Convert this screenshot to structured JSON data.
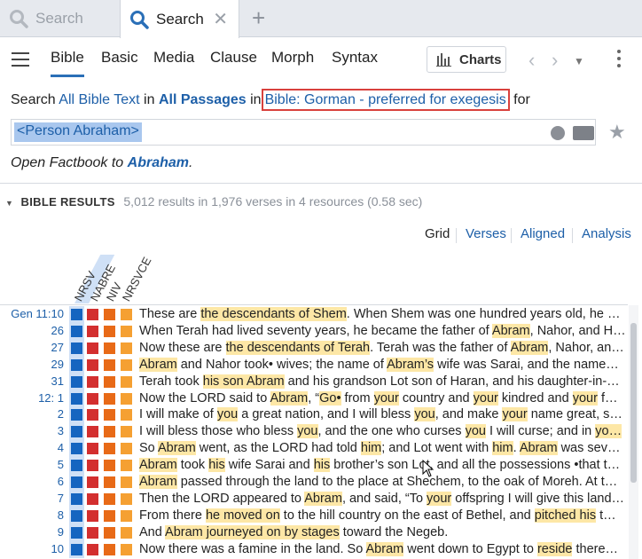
{
  "tabs": {
    "inactive_label": "Search",
    "active_label": "Search",
    "close_glyph": "✕",
    "new_glyph": "+"
  },
  "toolbar": {
    "tabs": [
      "Bible",
      "Basic",
      "Media",
      "Clause",
      "Morph",
      "Syntax"
    ],
    "selected": "Bible",
    "charts_label": "Charts"
  },
  "search": {
    "prefix": "Search",
    "scope": "All Bible Text",
    "in1": "in",
    "passages": "All Passages",
    "in2": "in",
    "resource": "Bible: Gorman - preferred for exegesis",
    "for": "for",
    "query": "<Person Abraham>"
  },
  "factbook": {
    "prefix": "Open Factbook to",
    "target": "Abraham",
    "suffix": "."
  },
  "results": {
    "title": "BIBLE RESULTS",
    "stats": "5,012 results in 1,976 verses in 4 resources (0.58 sec)"
  },
  "views": [
    "Grid",
    "Verses",
    "Aligned",
    "Analysis"
  ],
  "resources": [
    "NRSV",
    "NABRE",
    "NIV",
    "NRSVCE"
  ],
  "colors": {
    "nrsv": "#1565c0",
    "nabre": "#d32f2f",
    "niv": "#e86a17",
    "nrsvce": "#f5a032",
    "highlight": "#fde7a6",
    "link": "#1d5fa8"
  },
  "rows": [
    {
      "ref": "Gen 11:10",
      "segs": [
        [
          "These are ",
          0
        ],
        [
          "the descendants of Shem",
          1
        ],
        [
          ". When Shem was one hundred years old, he b…",
          0
        ]
      ]
    },
    {
      "ref": "26",
      "segs": [
        [
          "When Terah had lived seventy years, he became the father of ",
          0
        ],
        [
          "Abram",
          1
        ],
        [
          ", Nahor, and H…",
          0
        ]
      ]
    },
    {
      "ref": "27",
      "segs": [
        [
          "Now these are ",
          0
        ],
        [
          "the descendants of Terah",
          1
        ],
        [
          ". Terah was the father of ",
          0
        ],
        [
          "Abram",
          1
        ],
        [
          ", Nahor, an…",
          0
        ]
      ]
    },
    {
      "ref": "29",
      "segs": [
        [
          "Abram",
          1
        ],
        [
          " and Nahor took• wives; the name of ",
          0
        ],
        [
          "Abram’s",
          1
        ],
        [
          " wife was Sarai, and the name…",
          0
        ]
      ]
    },
    {
      "ref": "31",
      "segs": [
        [
          "Terah took ",
          0
        ],
        [
          "his son Abram",
          1
        ],
        [
          " and his grandson Lot son of Haran, and his daughter-in-…",
          0
        ]
      ]
    },
    {
      "ref": "12: 1",
      "segs": [
        [
          "Now the LORD said to ",
          0
        ],
        [
          "Abram",
          1
        ],
        [
          ", “",
          0
        ],
        [
          "Go•",
          1
        ],
        [
          " from ",
          0
        ],
        [
          "your",
          1
        ],
        [
          " country and ",
          0
        ],
        [
          "your",
          1
        ],
        [
          " kindred and ",
          0
        ],
        [
          "your",
          1
        ],
        [
          " f…",
          0
        ]
      ]
    },
    {
      "ref": "2",
      "segs": [
        [
          "I will make of ",
          0
        ],
        [
          "you",
          1
        ],
        [
          " a great nation, and I will bless ",
          0
        ],
        [
          "you",
          1
        ],
        [
          ", and make ",
          0
        ],
        [
          "your",
          1
        ],
        [
          " name great, s…",
          0
        ]
      ]
    },
    {
      "ref": "3",
      "segs": [
        [
          "I will bless those who bless ",
          0
        ],
        [
          "you",
          1
        ],
        [
          ", and the one who curses ",
          0
        ],
        [
          "you",
          1
        ],
        [
          " I will curse; and in ",
          0
        ],
        [
          "yo…",
          1
        ]
      ]
    },
    {
      "ref": "4",
      "segs": [
        [
          "So ",
          0
        ],
        [
          "Abram",
          1
        ],
        [
          " went, as the LORD had told ",
          0
        ],
        [
          "him",
          1
        ],
        [
          "; and Lot went with ",
          0
        ],
        [
          "him",
          1
        ],
        [
          ". ",
          0
        ],
        [
          "Abram",
          1
        ],
        [
          " was seve…",
          0
        ]
      ]
    },
    {
      "ref": "5",
      "segs": [
        [
          "Abram",
          1
        ],
        [
          " took ",
          0
        ],
        [
          "his",
          1
        ],
        [
          " wife Sarai and ",
          0
        ],
        [
          "his",
          1
        ],
        [
          " brother’s son Lot, and all the possessions •that t…",
          0
        ]
      ]
    },
    {
      "ref": "6",
      "segs": [
        [
          "Abram",
          1
        ],
        [
          " passed through the land to the place at Shechem, to the oak of Moreh. At t…",
          0
        ]
      ]
    },
    {
      "ref": "7",
      "segs": [
        [
          "Then the LORD appeared to ",
          0
        ],
        [
          "Abram",
          1
        ],
        [
          ", and said, “To ",
          0
        ],
        [
          "your",
          1
        ],
        [
          " offspring I will give this land…",
          0
        ]
      ]
    },
    {
      "ref": "8",
      "segs": [
        [
          "From there ",
          0
        ],
        [
          "he moved on",
          1
        ],
        [
          " to the hill country on the east of Bethel, and ",
          0
        ],
        [
          "pitched his",
          1
        ],
        [
          " t…",
          0
        ]
      ]
    },
    {
      "ref": "9",
      "segs": [
        [
          "And ",
          0
        ],
        [
          "Abram journeyed on by stages",
          1
        ],
        [
          " toward the Negeb.",
          0
        ]
      ]
    },
    {
      "ref": "10",
      "segs": [
        [
          "Now there was a famine in the land. So ",
          0
        ],
        [
          "Abram",
          1
        ],
        [
          " went down to Egypt to ",
          0
        ],
        [
          "reside",
          1
        ],
        [
          " there…",
          0
        ]
      ]
    }
  ]
}
